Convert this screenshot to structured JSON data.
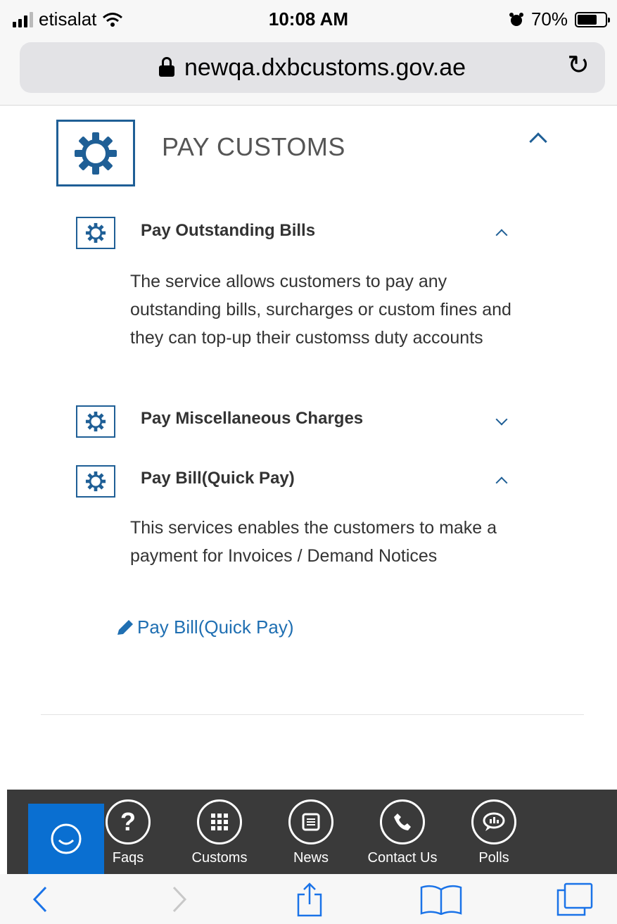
{
  "status_bar": {
    "carrier": "etisalat",
    "time": "10:08 AM",
    "battery": "70%",
    "battery_level": 0.7
  },
  "browser": {
    "url": "newqa.dxbcustoms.gov.ae"
  },
  "section": {
    "title": "PAY CUSTOMS",
    "expanded": true,
    "items": [
      {
        "title": "Pay Outstanding Bills",
        "expanded": true,
        "description": "The service allows customers to pay any outstanding bills, surcharges or custom fines and they can top-up their customss duty accounts"
      },
      {
        "title": "Pay Miscellaneous Charges",
        "expanded": false,
        "description": ""
      },
      {
        "title": "Pay Bill(Quick Pay)",
        "expanded": true,
        "description": "This services enables the customers to make a payment for Invoices / Demand Notices",
        "link": "Pay Bill(Quick Pay)"
      }
    ]
  },
  "app_nav": {
    "items": [
      {
        "label": "Faqs",
        "icon": "question-icon"
      },
      {
        "label": "Customs",
        "icon": "grid-icon"
      },
      {
        "label": "News",
        "icon": "newspaper-icon"
      },
      {
        "label": "Contact Us",
        "icon": "phone-icon"
      },
      {
        "label": "Polls",
        "icon": "poll-icon"
      }
    ],
    "chat_icon": "smile-chat-icon"
  },
  "colors": {
    "accent": "#1f5f96",
    "link": "#1f6fb2",
    "nav_bg": "#3a3a3a",
    "chat_bg": "#0a6fd1"
  }
}
